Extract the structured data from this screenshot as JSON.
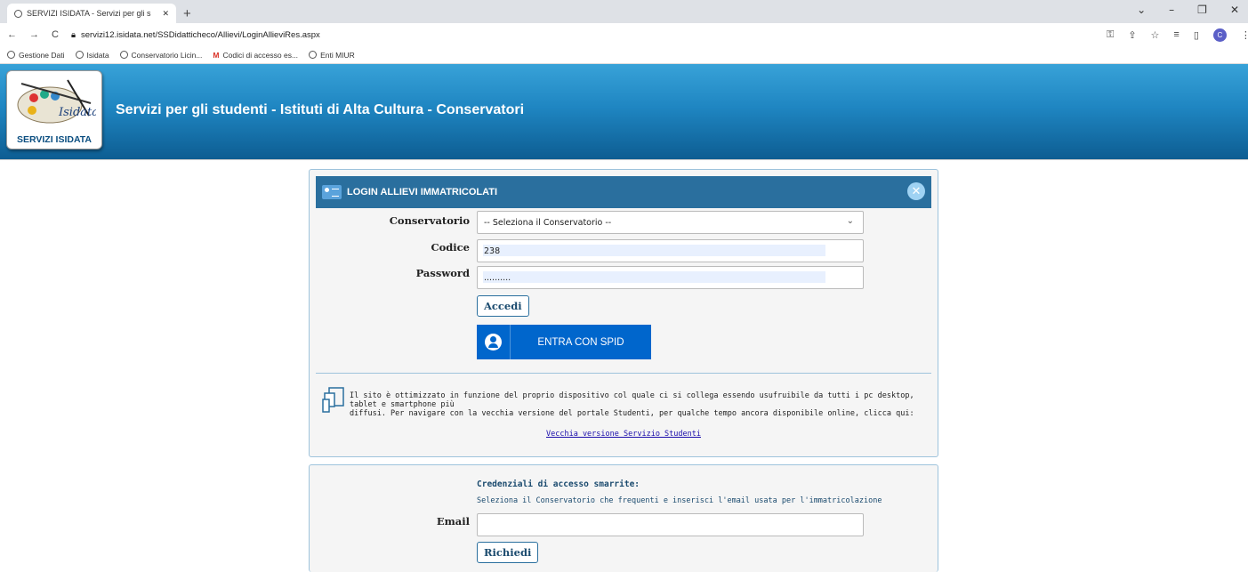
{
  "browser": {
    "tab_title": "SERVIZI ISIDATA - Servizi per gli s",
    "new_tab": "+",
    "url": "servizi12.isidata.net/SSDidatticheco/Allievi/LoginAllieviRes.aspx",
    "avatar": "C",
    "bookmarks": [
      "Gestione Dati",
      "Isidata",
      "Conservatorio Licin...",
      "Codici di accesso es...",
      "Enti MIUR"
    ]
  },
  "header": {
    "logo_label": "SERVIZI ISIDATA",
    "logo_text": "Isidata",
    "title": "Servizi per gli studenti - Istituti di Alta Cultura - Conservatori"
  },
  "login": {
    "title": "LOGIN ALLIEVI IMMATRICOLATI",
    "conservatorio_label": "Conservatorio",
    "conservatorio_value": "-- Seleziona il Conservatorio --",
    "codice_label": "Codice",
    "codice_value": "238",
    "password_label": "Password",
    "password_value": "..........",
    "accedi": "Accedi",
    "spid": "ENTRA CON SPID",
    "info_line1": "Il sito è ottimizzato in funzione del proprio dispositivo col quale ci si collega essendo usufruibile da tutti i pc desktop, tablet e smartphone più",
    "info_line2": "diffusi. Per navigare con la vecchia versione del portale Studenti, per qualche tempo ancora disponibile online, clicca qui:",
    "old_link": "Vecchia versione Servizio Studenti"
  },
  "recovery": {
    "title": "Credenziali di accesso smarrite:",
    "desc": "Seleziona il Conservatorio che frequenti e inserisci l'email usata per l'immatricolazione",
    "email_label": "Email",
    "email_value": "",
    "richiedi": "Richiedi"
  },
  "icons": [
    "globe-icon",
    "close-icon",
    "back-icon",
    "forward-icon",
    "reload-icon",
    "lock-icon",
    "key-icon",
    "share-icon",
    "star-icon",
    "gmail-icon",
    "id-card-icon",
    "user-circle-icon",
    "devices-icon",
    "chevron-down-icon"
  ],
  "colors": {
    "header_blue": "#1f86c2",
    "panel_title": "#2a6f9e",
    "spid_blue": "#0066cc"
  }
}
